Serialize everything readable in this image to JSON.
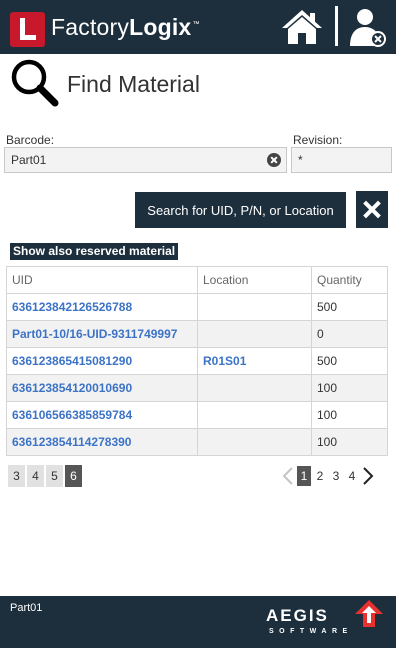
{
  "header": {
    "brand_plain": "Factory",
    "brand_bold": "Logix",
    "brand_tm": "™",
    "home_icon": "home-icon",
    "logout_icon": "user-remove-icon",
    "accent": "#c8192c",
    "bar_color": "#1d2e3c"
  },
  "page": {
    "title": "Find Material",
    "title_icon": "search-icon"
  },
  "form": {
    "barcode_label": "Barcode:",
    "barcode_value": "Part01",
    "revision_label": "Revision:",
    "revision_value": "*",
    "search_button": "Search for UID, P/N, or Location",
    "reserved_toggle": "Show also reserved material"
  },
  "table": {
    "columns": [
      "UID",
      "Location",
      "Quantity"
    ],
    "rows": [
      {
        "uid": "636123842126526788",
        "location": "",
        "quantity": "500"
      },
      {
        "uid": "Part01-10/16-UID-9311749997",
        "location": "",
        "quantity": "0"
      },
      {
        "uid": "636123865415081290",
        "location": "R01S01",
        "quantity": "500"
      },
      {
        "uid": "636123854120010690",
        "location": "",
        "quantity": "100"
      },
      {
        "uid": "636106566385859784",
        "location": "",
        "quantity": "100"
      },
      {
        "uid": "636123854114278390",
        "location": "",
        "quantity": "100"
      }
    ]
  },
  "pager_left": {
    "pages": [
      "3",
      "4",
      "5",
      "6"
    ],
    "active": "6"
  },
  "pager_right": {
    "pages": [
      "1",
      "2",
      "3",
      "4"
    ],
    "active": "1"
  },
  "footer": {
    "text": "Part01",
    "company": "AEGIS",
    "company_sub": "SOFTWARE"
  }
}
